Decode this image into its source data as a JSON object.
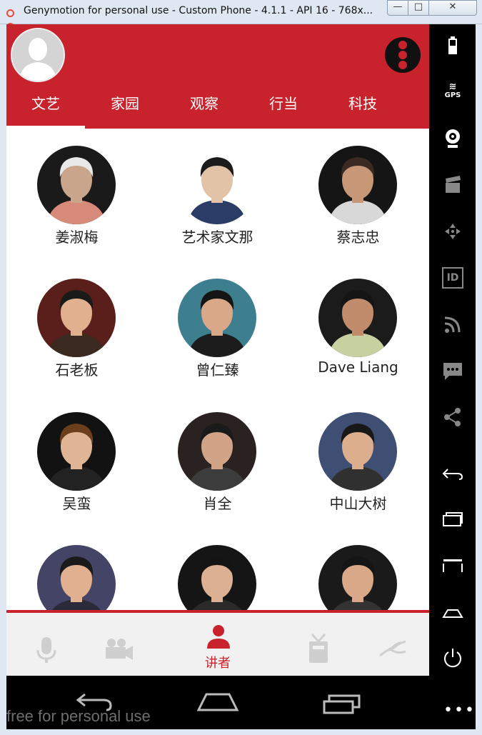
{
  "window": {
    "title": "Genymotion for personal use - Custom Phone - 4.1.1 - API 16 - 768x...",
    "minimize": "—",
    "maximize": "□",
    "close": "✕"
  },
  "header": {
    "tabs": [
      {
        "label": "文艺",
        "active": true
      },
      {
        "label": "家园",
        "active": false
      },
      {
        "label": "观察",
        "active": false
      },
      {
        "label": "行当",
        "active": false
      },
      {
        "label": "科技",
        "active": false
      }
    ],
    "accent": "#c8232c"
  },
  "speakers": [
    {
      "name": "姜淑梅",
      "bg": "#1a1a1a",
      "skin": "#c9a58b",
      "hair": "#e8e8e8",
      "shirt": "#d88a7a"
    },
    {
      "name": "艺术家文那",
      "bg": "#ffffff",
      "skin": "#e2c3a8",
      "hair": "#1b1b1b",
      "shirt": "#2b3d66"
    },
    {
      "name": "蔡志忠",
      "bg": "#151515",
      "skin": "#c79778",
      "hair": "#3a2a22",
      "shirt": "#d8d8d8"
    },
    {
      "name": "石老板",
      "bg": "#5a1f1a",
      "skin": "#e0b08f",
      "hair": "#1a1a1a",
      "shirt": "#3a2a20"
    },
    {
      "name": "曾仁臻",
      "bg": "#3d7f8f",
      "skin": "#d9a889",
      "hair": "#141414",
      "shirt": "#1c1c1c"
    },
    {
      "name": "Dave Liang",
      "bg": "#1b1b1b",
      "skin": "#c08c6c",
      "hair": "#151515",
      "shirt": "#c6d0a0"
    },
    {
      "name": "吴蛮",
      "bg": "#121212",
      "skin": "#e0b596",
      "hair": "#6b3e1e",
      "shirt": "#222222"
    },
    {
      "name": "肖全",
      "bg": "#2a2220",
      "skin": "#d2a487",
      "hair": "#1a1a1a",
      "shirt": "#3c3c3c"
    },
    {
      "name": "中山大树",
      "bg": "#3f4f73",
      "skin": "#dcae8e",
      "hair": "#181818",
      "shirt": "#303030"
    },
    {
      "name": "",
      "bg": "#444466",
      "skin": "#e0b090",
      "hair": "#1a1a1a",
      "shirt": "#2a2a3a"
    },
    {
      "name": "",
      "bg": "#151515",
      "skin": "#dcb092",
      "hair": "#141414",
      "shirt": "#2a2a2a"
    },
    {
      "name": "",
      "bg": "#1a1a1a",
      "skin": "#d8a888",
      "hair": "#151515",
      "shirt": "#333333"
    }
  ],
  "bottom_nav": [
    {
      "icon": "microphone-icon",
      "label": "",
      "active": false
    },
    {
      "icon": "video-camera-icon",
      "label": "",
      "active": false
    },
    {
      "icon": "speaker-person-icon",
      "label": "讲者",
      "active": true
    },
    {
      "icon": "radio-icon",
      "label": "",
      "active": false
    },
    {
      "icon": "plant-icon",
      "label": "",
      "active": false
    }
  ],
  "side_panel": {
    "icons": [
      "battery-icon",
      "gps-icon",
      "webcam-icon",
      "clapper-icon",
      "dpad-icon",
      "id-icon",
      "rss-icon",
      "sms-icon",
      "share-icon",
      "back-icon",
      "recent-apps-icon",
      "menu-icon",
      "home-icon",
      "power-icon",
      "more-icon"
    ],
    "gps_label": "GPS",
    "id_label": "ID"
  },
  "watermark": "free for personal use"
}
